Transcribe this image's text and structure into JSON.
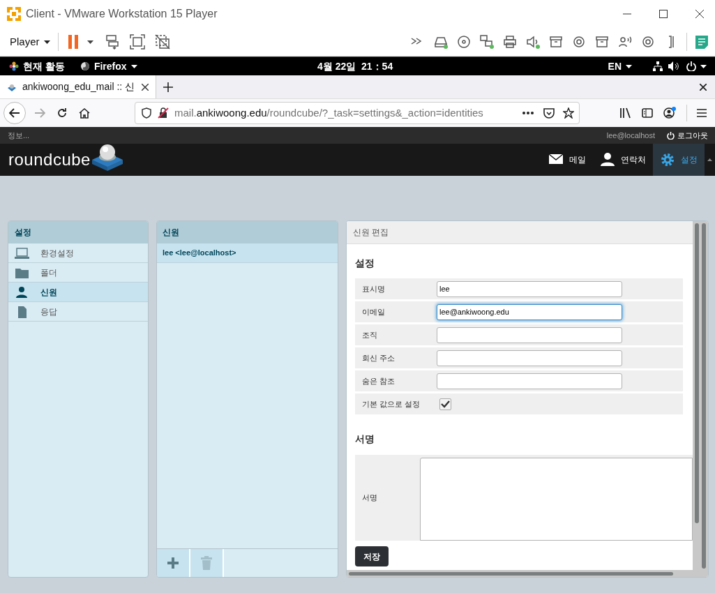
{
  "window": {
    "title": "Client - VMware Workstation 15 Player"
  },
  "vm_toolbar": {
    "player_menu": "Player"
  },
  "desktop_bar": {
    "activities": "현재 활동",
    "app_menu": "Firefox",
    "clock": "4월 22일  21：54",
    "input_method": "EN"
  },
  "browser": {
    "tabs": [
      {
        "label": "ankiwoong_edu_mail :: 신",
        "selected": true
      }
    ],
    "url": {
      "subdomain": "mail.",
      "domain": "ankiwoong.edu",
      "path": "/roundcube/?_task=settings&_action=identities"
    }
  },
  "logo": "roundcube",
  "topline": {
    "message": "정보...",
    "user": "lee@localhost",
    "logout": "로그아웃"
  },
  "nav": [
    {
      "label": "메일",
      "kind": "mail",
      "selected": false
    },
    {
      "label": "연락처",
      "kind": "contacts",
      "selected": false
    },
    {
      "label": "설정",
      "kind": "settings",
      "selected": true
    }
  ],
  "settings_panel": {
    "title": "설정",
    "items": [
      {
        "label": "환경설정",
        "kind": "preferences",
        "selected": false
      },
      {
        "label": "폴더",
        "kind": "folders",
        "selected": false
      },
      {
        "label": "신원",
        "kind": "identities",
        "selected": true
      },
      {
        "label": "응답",
        "kind": "responses",
        "selected": false
      }
    ]
  },
  "identities_panel": {
    "title": "신원",
    "rows": [
      {
        "label": "lee <lee@localhost>",
        "selected": true
      }
    ],
    "delete_disabled": true
  },
  "edit_panel": {
    "title": "신원 편집",
    "section": "설정",
    "fields": [
      {
        "kind": "text",
        "label": "표시명",
        "value": "lee",
        "focused": false
      },
      {
        "kind": "text",
        "label": "이메일",
        "value": "lee@ankiwoong.edu",
        "focused": true
      },
      {
        "kind": "text",
        "label": "조직",
        "focused": false
      },
      {
        "kind": "text",
        "label": "회신 주소",
        "focused": false
      },
      {
        "kind": "text",
        "label": "숨은 참조",
        "focused": false
      },
      {
        "kind": "checkbox",
        "label": "기본 값으로 설정",
        "checked": true
      }
    ],
    "signature_section": "서명",
    "signature_label": "서명",
    "save_button": "저장"
  }
}
